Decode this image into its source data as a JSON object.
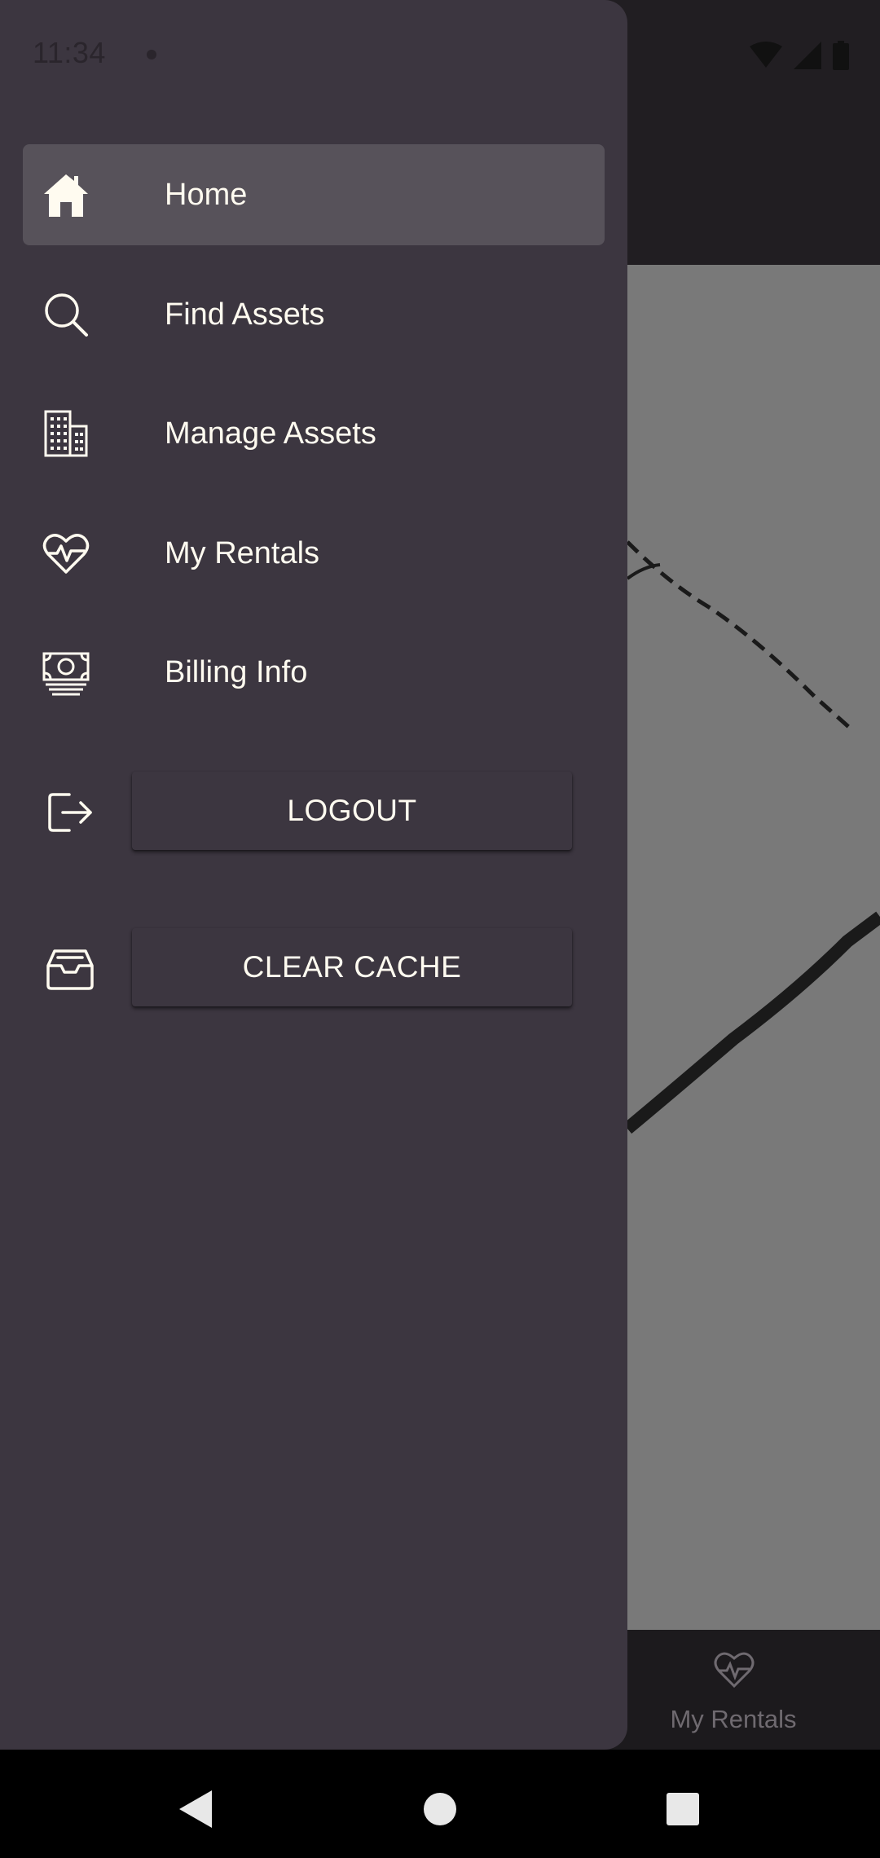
{
  "status_bar": {
    "time": "11:34"
  },
  "drawer": {
    "items": [
      {
        "label": "Home",
        "icon": "home-icon",
        "active": true
      },
      {
        "label": "Find Assets",
        "icon": "search-icon",
        "active": false
      },
      {
        "label": "Manage Assets",
        "icon": "building-icon",
        "active": false
      },
      {
        "label": "My Rentals",
        "icon": "heart-pulse-icon",
        "active": false
      },
      {
        "label": "Billing Info",
        "icon": "money-icon",
        "active": false
      }
    ],
    "logout_label": "LOGOUT",
    "clear_cache_label": "CLEAR CACHE"
  },
  "background": {
    "bottom_nav": {
      "label": "My Rentals",
      "icon": "heart-pulse-icon"
    }
  },
  "colors": {
    "drawer_bg": "#3c3640",
    "active_item_bg": "#57525a",
    "text": "#fffbf0"
  }
}
